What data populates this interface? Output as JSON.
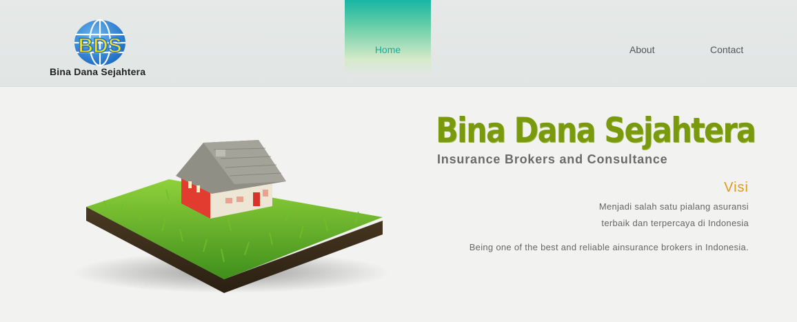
{
  "header": {
    "logo": {
      "monogram": "BDS",
      "name": "Bina Dana Sejahtera"
    },
    "nav": {
      "home": "Home",
      "about": "About",
      "contact": "Contact"
    }
  },
  "hero": {
    "title": "Bina Dana Sejahtera",
    "subtitle": "Insurance Brokers and Consultance",
    "visi_title": "Visi",
    "visi_id_line1": "Menjadi salah satu pialang asuransi",
    "visi_id_line2": "terbaik dan terpercaya di Indonesia",
    "visi_en": "Being one of the best and reliable ainsurance brokers in Indonesia."
  },
  "colors": {
    "accent_teal": "#18b5a4",
    "title_green": "#7a9a0e",
    "visi_orange": "#e0991c",
    "globe_blue": "#2a7fd0",
    "monogram_yellow": "#f4e026"
  }
}
